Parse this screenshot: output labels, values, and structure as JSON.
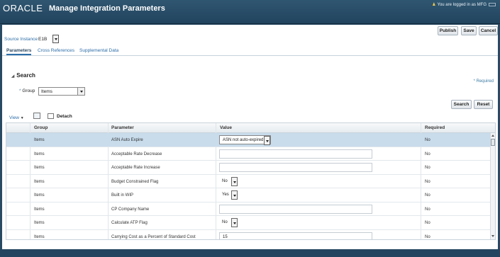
{
  "header": {
    "logo": "ORACLE",
    "title": "Manage Integration Parameters",
    "logged_in": "You are logged in as MFG"
  },
  "actions": {
    "publish": "Publish",
    "save": "Save",
    "cancel": "Cancel"
  },
  "source_instance": {
    "label": "Source Instance",
    "value": "E1B"
  },
  "tabs": [
    {
      "label": "Parameters"
    },
    {
      "label": "Cross References"
    },
    {
      "label": "Supplemental Data"
    }
  ],
  "search": {
    "title": "Search",
    "required_note": "Required",
    "group_label": "Group",
    "group_value": "Items",
    "search_button": "Search",
    "reset_button": "Reset"
  },
  "toolbar": {
    "view": "View",
    "detach": "Detach"
  },
  "table": {
    "headers": [
      "Group",
      "Parameter",
      "Value",
      "Required"
    ],
    "rows": [
      {
        "group": "Items",
        "parameter": "ASN Auto Expire",
        "value": "ASN not auto-expired",
        "required": "No"
      },
      {
        "group": "Items",
        "parameter": "Acceptable Rate Decrease",
        "value": "",
        "required": "No"
      },
      {
        "group": "Items",
        "parameter": "Acceptable Rate Increase",
        "value": "",
        "required": "No"
      },
      {
        "group": "Items",
        "parameter": "Budget Constrained Flag",
        "value": "No",
        "required": "No"
      },
      {
        "group": "Items",
        "parameter": "Built in WIP",
        "value": "Yes",
        "required": "No"
      },
      {
        "group": "Items",
        "parameter": "CP Company Name",
        "value": "",
        "required": "No"
      },
      {
        "group": "Items",
        "parameter": "Calculate ATP Flag",
        "value": "No",
        "required": "No"
      },
      {
        "group": "Items",
        "parameter": "Carrying Cost as a Percent of Standard Cost",
        "value": "15",
        "required": "No"
      }
    ]
  },
  "colors": {
    "header_bg": "#2a4a64",
    "link": "#2d6ea8",
    "selected_row": "#c8dcec"
  }
}
